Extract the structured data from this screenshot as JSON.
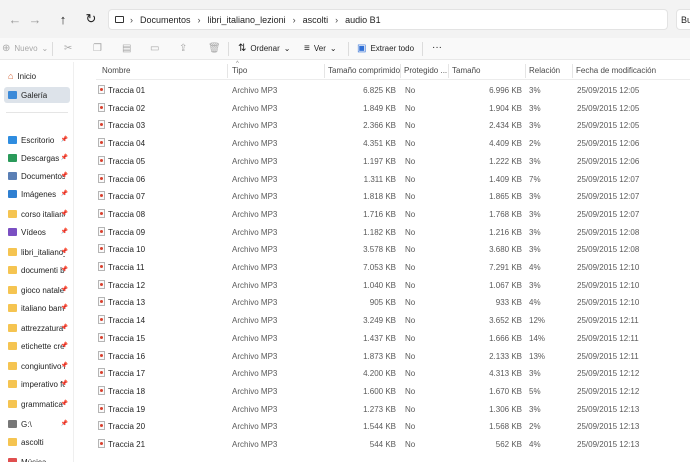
{
  "address": {
    "crumbs": [
      "Documentos",
      "libri_italiano_lezioni",
      "ascolti",
      "audio B1"
    ],
    "search_prefix": "Bu"
  },
  "toolbar": {
    "new_label": "Nuevo",
    "sort_label": "Ordenar",
    "view_label": "Ver",
    "extract_label": "Extraer todo",
    "more_label": "···"
  },
  "sidebar": {
    "top_items": [
      {
        "label": "Inicio",
        "icon": "home-icon",
        "selected": false
      },
      {
        "label": "Galería",
        "icon": "gallery-icon",
        "selected": true
      }
    ],
    "items": [
      {
        "label": "Escritorio",
        "icon": "desktop-icon",
        "pinned": true
      },
      {
        "label": "Descargas",
        "icon": "download-icon",
        "pinned": true
      },
      {
        "label": "Documentos",
        "icon": "documents-icon",
        "pinned": true
      },
      {
        "label": "Imágenes",
        "icon": "images-icon",
        "pinned": true
      },
      {
        "label": "corso italiano",
        "icon": "folder-icon",
        "pinned": true
      },
      {
        "label": "Vídeos",
        "icon": "videos-icon",
        "pinned": true
      },
      {
        "label": "libri_italiano_",
        "icon": "folder-icon",
        "pinned": true
      },
      {
        "label": "documenti b",
        "icon": "folder-icon",
        "pinned": true
      },
      {
        "label": "gioco natale",
        "icon": "folder-icon",
        "pinned": true
      },
      {
        "label": "italiano bam",
        "icon": "folder-icon",
        "pinned": true
      },
      {
        "label": "attrezzatura s",
        "icon": "folder-icon",
        "pinned": true
      },
      {
        "label": "etichette cre",
        "icon": "folder-icon",
        "pinned": true
      },
      {
        "label": "congiuntivo i",
        "icon": "folder-icon",
        "pinned": true
      },
      {
        "label": "imperativo fo",
        "icon": "folder-icon",
        "pinned": true
      },
      {
        "label": "grammatica",
        "icon": "folder-icon",
        "pinned": true
      },
      {
        "label": "G:\\",
        "icon": "drive-icon",
        "pinned": true
      },
      {
        "label": "ascolti",
        "icon": "folder-icon",
        "pinned": false
      },
      {
        "label": "Música",
        "icon": "music-icon",
        "pinned": false
      }
    ]
  },
  "columns": [
    "Nombre",
    "Tipo",
    "Tamaño comprimido",
    "Protegido ...",
    "Tamaño",
    "Relación",
    "Fecha de modificación"
  ],
  "files": [
    {
      "name": "Traccia 01",
      "type": "Archivo MP3",
      "compressed": "6.825 KB",
      "protected": "No",
      "size": "6.996 KB",
      "ratio": "3%",
      "date": "25/09/2015 12:05"
    },
    {
      "name": "Traccia 02",
      "type": "Archivo MP3",
      "compressed": "1.849 KB",
      "protected": "No",
      "size": "1.904 KB",
      "ratio": "3%",
      "date": "25/09/2015 12:05"
    },
    {
      "name": "Traccia 03",
      "type": "Archivo MP3",
      "compressed": "2.366 KB",
      "protected": "No",
      "size": "2.434 KB",
      "ratio": "3%",
      "date": "25/09/2015 12:05"
    },
    {
      "name": "Traccia 04",
      "type": "Archivo MP3",
      "compressed": "4.351 KB",
      "protected": "No",
      "size": "4.409 KB",
      "ratio": "2%",
      "date": "25/09/2015 12:06"
    },
    {
      "name": "Traccia 05",
      "type": "Archivo MP3",
      "compressed": "1.197 KB",
      "protected": "No",
      "size": "1.222 KB",
      "ratio": "3%",
      "date": "25/09/2015 12:06"
    },
    {
      "name": "Traccia 06",
      "type": "Archivo MP3",
      "compressed": "1.311 KB",
      "protected": "No",
      "size": "1.409 KB",
      "ratio": "7%",
      "date": "25/09/2015 12:07"
    },
    {
      "name": "Traccia 07",
      "type": "Archivo MP3",
      "compressed": "1.818 KB",
      "protected": "No",
      "size": "1.865 KB",
      "ratio": "3%",
      "date": "25/09/2015 12:07"
    },
    {
      "name": "Traccia 08",
      "type": "Archivo MP3",
      "compressed": "1.716 KB",
      "protected": "No",
      "size": "1.768 KB",
      "ratio": "3%",
      "date": "25/09/2015 12:07"
    },
    {
      "name": "Traccia 09",
      "type": "Archivo MP3",
      "compressed": "1.182 KB",
      "protected": "No",
      "size": "1.216 KB",
      "ratio": "3%",
      "date": "25/09/2015 12:08"
    },
    {
      "name": "Traccia 10",
      "type": "Archivo MP3",
      "compressed": "3.578 KB",
      "protected": "No",
      "size": "3.680 KB",
      "ratio": "3%",
      "date": "25/09/2015 12:08"
    },
    {
      "name": "Traccia 11",
      "type": "Archivo MP3",
      "compressed": "7.053 KB",
      "protected": "No",
      "size": "7.291 KB",
      "ratio": "4%",
      "date": "25/09/2015 12:10"
    },
    {
      "name": "Traccia 12",
      "type": "Archivo MP3",
      "compressed": "1.040 KB",
      "protected": "No",
      "size": "1.067 KB",
      "ratio": "3%",
      "date": "25/09/2015 12:10"
    },
    {
      "name": "Traccia 13",
      "type": "Archivo MP3",
      "compressed": "905 KB",
      "protected": "No",
      "size": "933 KB",
      "ratio": "4%",
      "date": "25/09/2015 12:10"
    },
    {
      "name": "Traccia 14",
      "type": "Archivo MP3",
      "compressed": "3.249 KB",
      "protected": "No",
      "size": "3.652 KB",
      "ratio": "12%",
      "date": "25/09/2015 12:11"
    },
    {
      "name": "Traccia 15",
      "type": "Archivo MP3",
      "compressed": "1.437 KB",
      "protected": "No",
      "size": "1.666 KB",
      "ratio": "14%",
      "date": "25/09/2015 12:11"
    },
    {
      "name": "Traccia 16",
      "type": "Archivo MP3",
      "compressed": "1.873 KB",
      "protected": "No",
      "size": "2.133 KB",
      "ratio": "13%",
      "date": "25/09/2015 12:11"
    },
    {
      "name": "Traccia 17",
      "type": "Archivo MP3",
      "compressed": "4.200 KB",
      "protected": "No",
      "size": "4.313 KB",
      "ratio": "3%",
      "date": "25/09/2015 12:12"
    },
    {
      "name": "Traccia 18",
      "type": "Archivo MP3",
      "compressed": "1.600 KB",
      "protected": "No",
      "size": "1.670 KB",
      "ratio": "5%",
      "date": "25/09/2015 12:12"
    },
    {
      "name": "Traccia 19",
      "type": "Archivo MP3",
      "compressed": "1.273 KB",
      "protected": "No",
      "size": "1.306 KB",
      "ratio": "3%",
      "date": "25/09/2015 12:13"
    },
    {
      "name": "Traccia 20",
      "type": "Archivo MP3",
      "compressed": "1.544 KB",
      "protected": "No",
      "size": "1.568 KB",
      "ratio": "2%",
      "date": "25/09/2015 12:13"
    },
    {
      "name": "Traccia 21",
      "type": "Archivo MP3",
      "compressed": "544 KB",
      "protected": "No",
      "size": "562 KB",
      "ratio": "4%",
      "date": "25/09/2015 12:13"
    }
  ],
  "colors": {
    "selected_bg": "#dde3ea",
    "folder": "#f5c451",
    "accent_blue": "#2f6fd6"
  }
}
